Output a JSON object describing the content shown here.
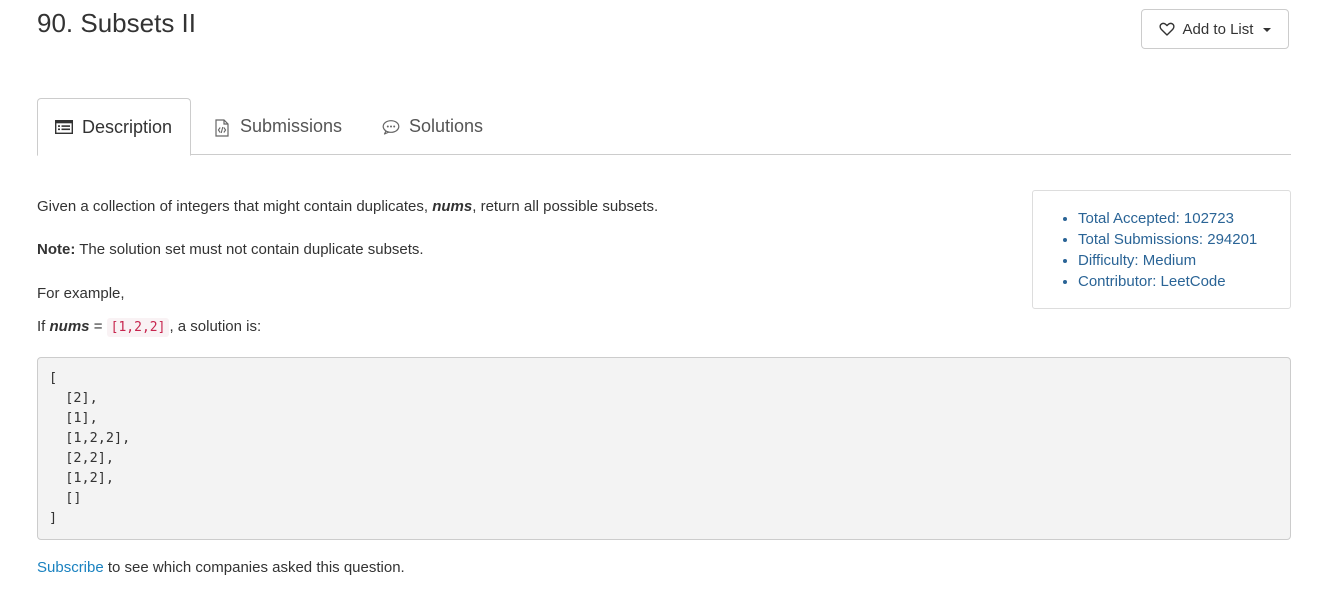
{
  "problem": {
    "title": "90. Subsets II"
  },
  "header": {
    "add_to_list_label": "Add to List"
  },
  "tabs": [
    {
      "label": "Description",
      "icon": "list-icon",
      "active": true
    },
    {
      "label": "Submissions",
      "icon": "code-file-icon",
      "active": false
    },
    {
      "label": "Solutions",
      "icon": "chat-bubble-icon",
      "active": false
    }
  ],
  "description": {
    "p1_before": "Given a collection of integers that might contain duplicates, ",
    "p1_var": "nums",
    "p1_after": ", return all possible subsets.",
    "note_label": "Note:",
    "note_text": " The solution set must not contain duplicate subsets.",
    "example_intro": "For example,",
    "if_label": "If ",
    "if_var": "nums",
    "if_eq": " = ",
    "if_value": "[1,2,2]",
    "if_after": ", a solution is:",
    "code_block": "[\n  [2],\n  [1],\n  [1,2,2],\n  [2,2],\n  [1,2],\n  []\n]"
  },
  "stats": {
    "total_accepted": "Total Accepted: 102723",
    "total_submissions": "Total Submissions: 294201",
    "difficulty": "Difficulty: Medium",
    "contributor": "Contributor: LeetCode"
  },
  "footer": {
    "subscribe_link": "Subscribe",
    "subscribe_text": " to see which companies asked this question."
  },
  "colors": {
    "link": "#1a82c0",
    "stats_text": "#2a6496",
    "inline_code": "#c7254e",
    "code_bg": "#f3f3f3"
  }
}
